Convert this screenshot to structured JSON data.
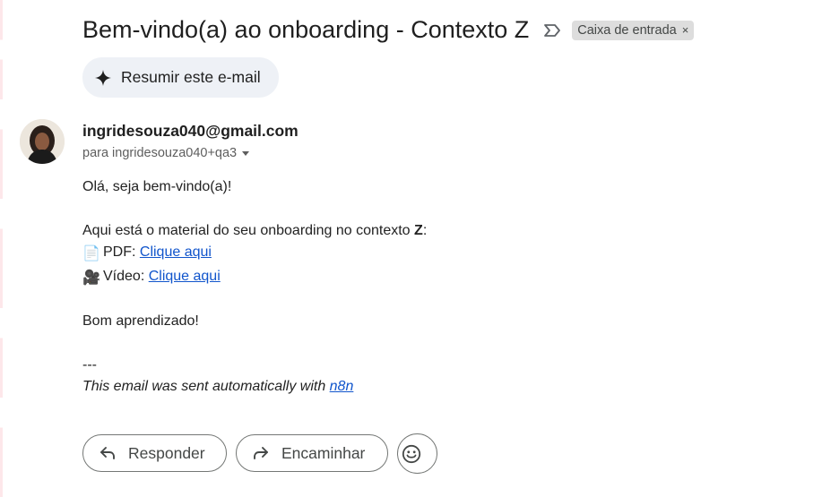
{
  "email": {
    "subject": "Bem-vindo(a) ao onboarding - Contexto Z",
    "importance_icon": "importance-marker-icon",
    "label": "Caixa de entrada",
    "label_remove": "×",
    "summarize_label": "Resumir este e-mail",
    "sender": "ingridesouza040@gmail.com",
    "recipient": "para ingridesouza040+qa3",
    "body": {
      "greeting": "Olá, seja bem-vindo(a)!",
      "intro_prefix": "Aqui está o material do seu onboarding no contexto ",
      "intro_bold": "Z",
      "intro_suffix": ":",
      "pdf_emoji": "📄",
      "pdf_prefix": "PDF: ",
      "pdf_link": "Clique aqui",
      "video_emoji": "🎥",
      "video_prefix": "Vídeo: ",
      "video_link": "Clique aqui",
      "closing": "Bom aprendizado!",
      "separator": "---",
      "footer_prefix": "This email was sent automatically with ",
      "footer_link": "n8n"
    },
    "actions": {
      "reply": "Responder",
      "forward": "Encaminhar"
    }
  }
}
